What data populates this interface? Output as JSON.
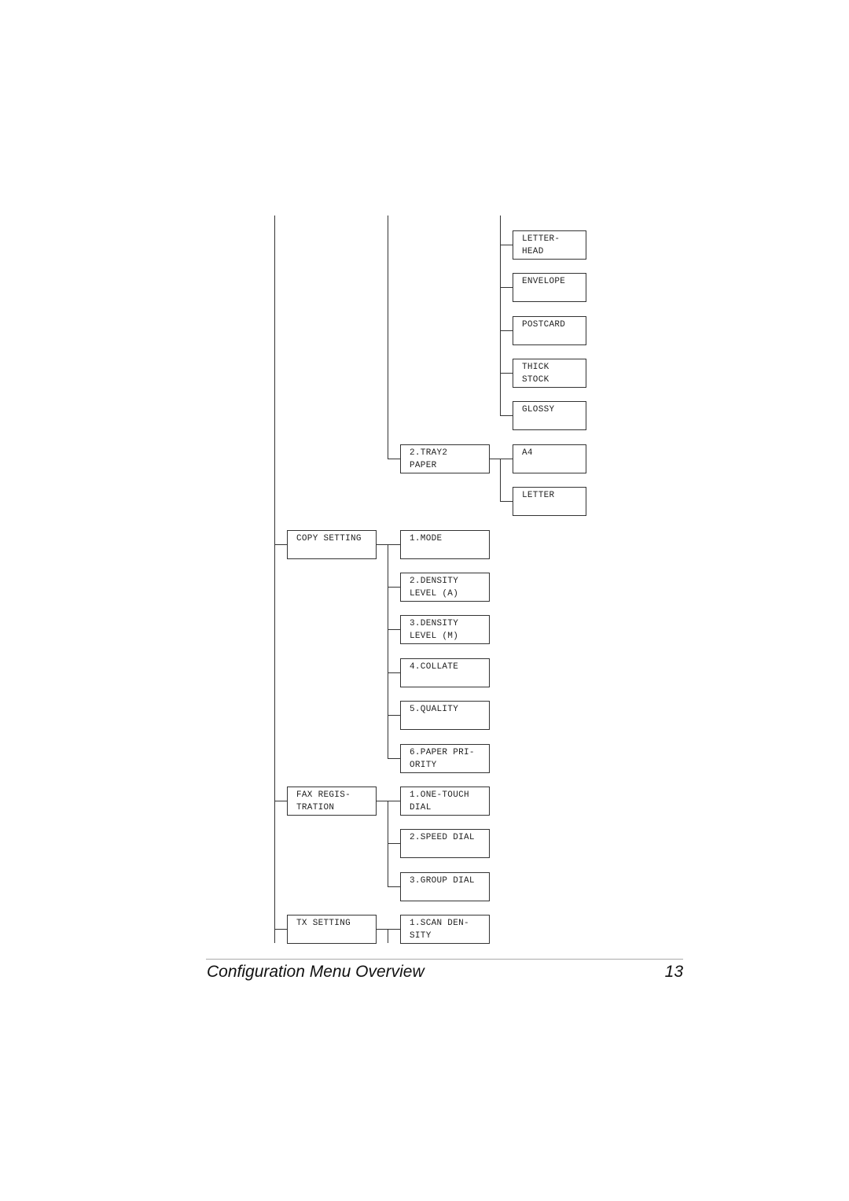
{
  "menu_tree": {
    "paper_types": [
      {
        "label": "LETTER-\nHEAD"
      },
      {
        "label": "ENVELOPE"
      },
      {
        "label": "POSTCARD"
      },
      {
        "label": "THICK\nSTOCK"
      },
      {
        "label": "GLOSSY"
      }
    ],
    "tray2": {
      "label": "2.TRAY2\nPAPER",
      "children": [
        {
          "label": "A4"
        },
        {
          "label": "LETTER"
        }
      ]
    },
    "copy_setting": {
      "label": "COPY SETTING",
      "children": [
        {
          "label": "1.MODE"
        },
        {
          "label": "2.DENSITY\nLEVEL (A)"
        },
        {
          "label": "3.DENSITY\nLEVEL (M)"
        },
        {
          "label": "4.COLLATE"
        },
        {
          "label": "5.QUALITY"
        },
        {
          "label": "6.PAPER PRI-\nORITY"
        }
      ]
    },
    "fax_registration": {
      "label": "FAX REGIS-\nTRATION",
      "children": [
        {
          "label": "1.ONE-TOUCH\nDIAL"
        },
        {
          "label": "2.SPEED DIAL"
        },
        {
          "label": "3.GROUP DIAL"
        }
      ]
    },
    "tx_setting": {
      "label": "TX SETTING",
      "children": [
        {
          "label": "1.SCAN DEN-\nSITY"
        }
      ]
    }
  },
  "footer": {
    "title": "Configuration Menu Overview",
    "page_number": "13"
  }
}
